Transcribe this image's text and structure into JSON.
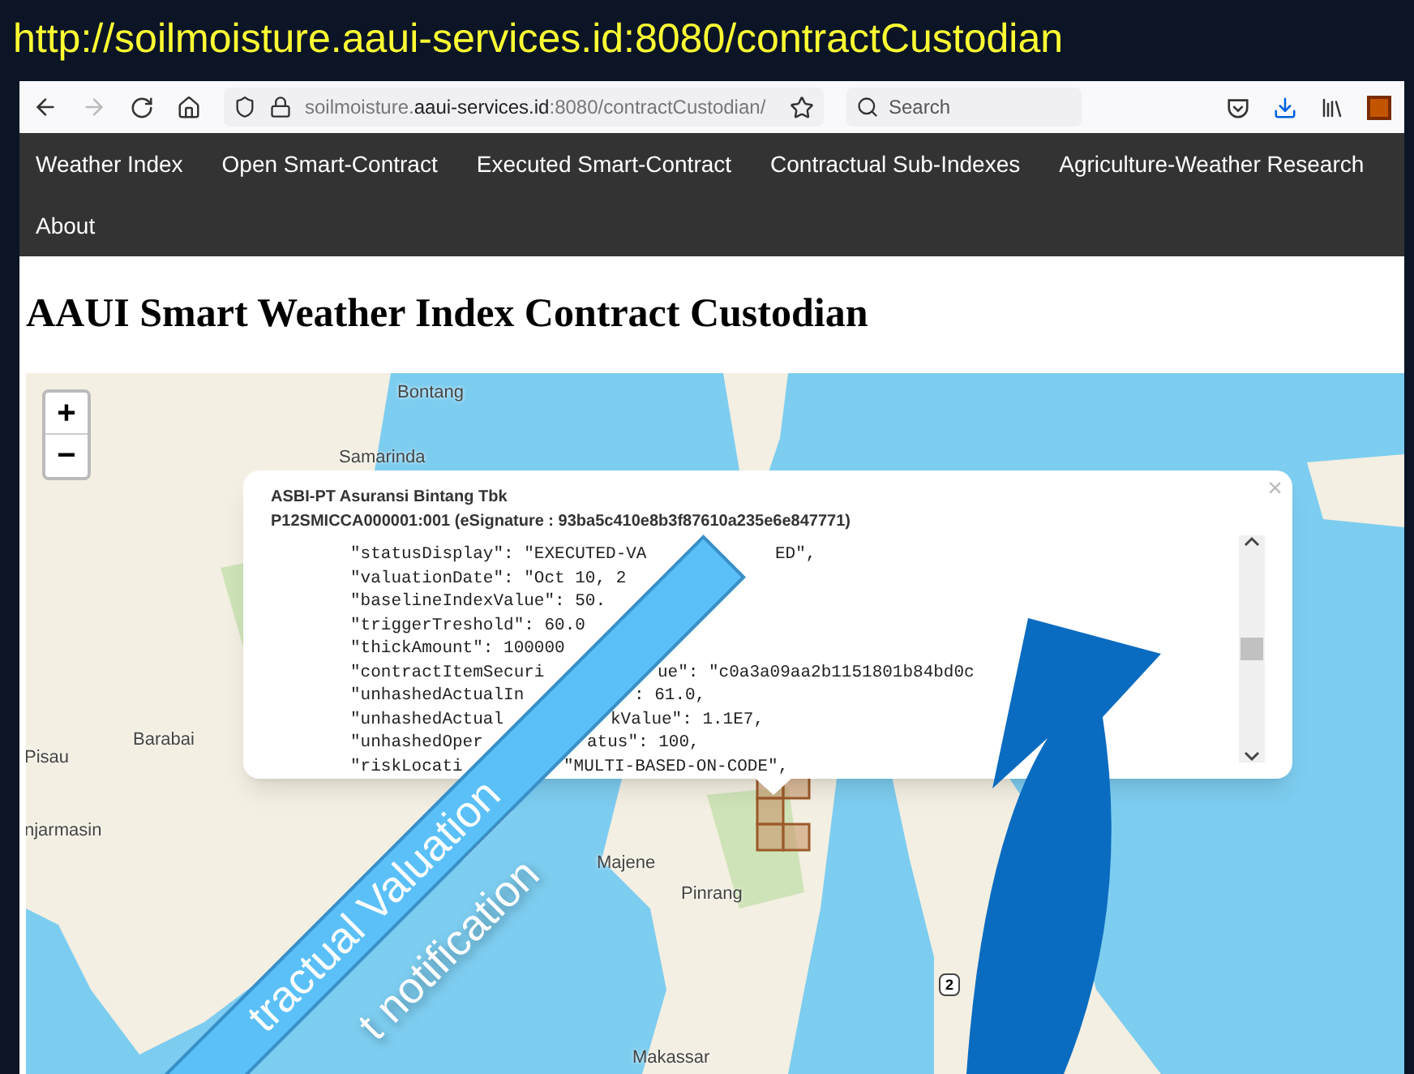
{
  "slide_title": "http://soilmoisture.aaui-services.id:8080/contractCustodian",
  "browser": {
    "forward_disabled": true,
    "url": {
      "pre": "soilmoisture.",
      "domain": "aaui-services.id",
      "post": ":8080/contractCustodian/"
    },
    "search": {
      "placeholder": "Search"
    }
  },
  "nav": [
    "Weather Index",
    "Open Smart-Contract",
    "Executed Smart-Contract",
    "Contractual Sub-Indexes",
    "Agriculture-Weather Research",
    "About"
  ],
  "page_title": "AAUI Smart Weather Index Contract Custodian",
  "map": {
    "zoom_in": "+",
    "zoom_out": "−",
    "road_shield": "2",
    "places": [
      {
        "name": "Bontang"
      },
      {
        "name": "Samarinda"
      },
      {
        "name": "Barabai"
      },
      {
        "name": "Pisau"
      },
      {
        "name": "njarmasin"
      },
      {
        "name": "Majene"
      },
      {
        "name": "Pinrang"
      },
      {
        "name": "Makassar"
      }
    ]
  },
  "popup": {
    "close": "×",
    "title": "ASBI-PT Asuransi Bintang Tbk",
    "subtitle": "P12SMICCA000001:001 (eSignature : 93ba5c410e8b3f87610a235e6e847771)",
    "code_lines": [
      {
        "pre": "\"statusDisplay\": \"EXECUTED-VA",
        "post": "ED\","
      },
      {
        "pre": "\"valuationDate\": \"Oct 10, 2"
      },
      {
        "pre": "\"baselineIndexValue\": 50."
      },
      {
        "pre": "\"triggerTreshold\": 60.0"
      },
      {
        "pre": "\"thickAmount\": 100000"
      },
      {
        "pre": "\"contractItemSecuri",
        "post": "ue\": \"c0a3a09aa2b1151801b84bd0c"
      },
      {
        "pre": "\"unhashedActualIn",
        "post": ": 61.0,"
      },
      {
        "pre": "\"unhashedActual",
        "post": "kValue\": 1.1E7,"
      },
      {
        "pre": "\"unhashedOper",
        "post": "atus\": 100,"
      },
      {
        "pre": "\"riskLocati",
        "post": "\"MULTI-BASED-ON-CODE\","
      }
    ]
  },
  "annotations": [
    {
      "kind": "banner",
      "text": "tractual Valuation"
    },
    {
      "kind": "caption",
      "text": "t notification"
    }
  ]
}
